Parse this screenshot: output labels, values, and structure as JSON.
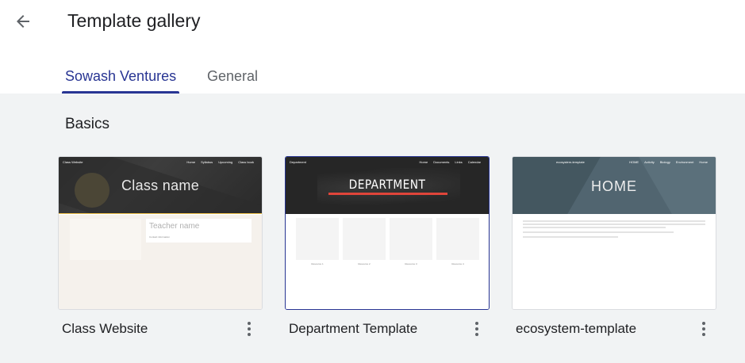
{
  "header": {
    "title": "Template gallery",
    "back_icon": "arrow-back-icon"
  },
  "tabs": [
    {
      "label": "Sowash Ventures",
      "active": true
    },
    {
      "label": "General",
      "active": false
    }
  ],
  "section": {
    "title": "Basics"
  },
  "colors": {
    "accent": "#283593",
    "text_primary": "#202124",
    "text_secondary": "#5f6368",
    "background": "#f1f3f4"
  },
  "templates": [
    {
      "name": "Class Website",
      "selected": false,
      "preview": {
        "site_title": "Class Website",
        "nav": [
          "Home",
          "Syllabus",
          "Upcoming",
          "Class book"
        ],
        "hero": "Class name",
        "teacher_name": "Teacher name",
        "teacher_sub": "Contact information"
      }
    },
    {
      "name": "Department Template",
      "selected": true,
      "preview": {
        "site_title": "Department",
        "nav": [
          "Home",
          "Documents",
          "Links",
          "Calendar"
        ],
        "hero": "DEPARTMENT",
        "tiles": [
          "Resource 1",
          "Resource 2",
          "Resource 3",
          "Resource 4"
        ]
      }
    },
    {
      "name": "ecosystem-template",
      "selected": false,
      "preview": {
        "site_title": "ecosystem-template",
        "nav": [
          "HOME",
          "Activity",
          "Biology",
          "Environment",
          "Home"
        ],
        "hero": "HOME"
      }
    }
  ]
}
